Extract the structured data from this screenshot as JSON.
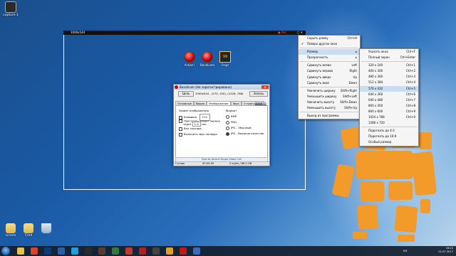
{
  "desktop": {
    "top_icon": {
      "label": "capture 1"
    },
    "bottom_icons": [
      {
        "label": "screen",
        "icon": "folder-icon"
      },
      {
        "label": "Cmd",
        "icon": "folder-icon"
      },
      {
        "label": "",
        "icon": "recycle-bin-icon"
      }
    ],
    "apps": [
      {
        "label": "Action!",
        "icon": "action-record-icon"
      },
      {
        "label": "Bandicam",
        "icon": "bandicam-record-icon"
      },
      {
        "label": "Fraps",
        "icon": "fraps-icon"
      }
    ]
  },
  "capture_bar": {
    "resolution": "1000x544",
    "rec": "● REC",
    "controls": "▢ ✕"
  },
  "bandicam": {
    "title": "Bandicam (Не зарегистрировано)",
    "target_label": "Цель",
    "region_text": "1000x544 - (270, 150), (1228, 766)",
    "record_button": "Запись",
    "tabs": [
      "Основные",
      "Видео",
      "Изображение",
      "Звук",
      "О программе"
    ],
    "active_tab": "Изображение",
    "help_link": "Помощь",
    "capture_header": "Захват изображения",
    "hotkey_label": "Клавиша",
    "hotkey_value": "F11",
    "repeat_label": "Повторять захват экрана",
    "repeat_every": "через",
    "repeat_value": "1.0",
    "repeat_unit": "сек.",
    "cursor_label": "Вкл курсора",
    "shutter_label": "Включить звук затвора",
    "format_header": "Формат",
    "formats": [
      "BMP",
      "PNG",
      "JPG - Обычный",
      "JPG - Высокое качество"
    ],
    "selected_format_index": 3,
    "footer_link": "How to record Skype Video Call",
    "status_left": "Готово",
    "status_time": "00:00:00",
    "status_size": "0 bytes / 86.0 GB"
  },
  "context_menu": {
    "items": [
      {
        "label": "Скрыть рамку",
        "shortcut": "Ctrl+H",
        "checked": false
      },
      {
        "label": "Поверх других окон",
        "shortcut": "",
        "checked": true
      },
      {
        "sep": true
      },
      {
        "label": "Размер",
        "shortcut": "▸",
        "hl": true
      },
      {
        "label": "Прозрачность",
        "shortcut": "▸"
      },
      {
        "sep": true
      },
      {
        "label": "Сдвинуть влево",
        "shortcut": "Left"
      },
      {
        "label": "Сдвинуть вправо",
        "shortcut": "Right"
      },
      {
        "label": "Сдвинуть вверх",
        "shortcut": "Up"
      },
      {
        "label": "Сдвинуть вниз",
        "shortcut": "Down"
      },
      {
        "sep": true
      },
      {
        "label": "Увеличить ширину",
        "shortcut": "Shift+Right"
      },
      {
        "label": "Уменьшить ширину",
        "shortcut": "Shift+Left"
      },
      {
        "label": "Увеличить высоту",
        "shortcut": "Shift+Down"
      },
      {
        "label": "Уменьшить высоту",
        "shortcut": "Shift+Up"
      },
      {
        "sep": true
      },
      {
        "label": "Выход из программы",
        "shortcut": ""
      }
    ]
  },
  "size_submenu": {
    "items": [
      {
        "label": "Указать окно",
        "shortcut": "Ctrl+F"
      },
      {
        "label": "Полный экран",
        "shortcut": "Ctrl+Enter"
      },
      {
        "sep": true
      },
      {
        "label": "320 x 240",
        "shortcut": "Ctrl+1"
      },
      {
        "label": "400 x 300",
        "shortcut": "Ctrl+2"
      },
      {
        "label": "480 x 360",
        "shortcut": "Ctrl+3"
      },
      {
        "label": "512 x 384",
        "shortcut": "Ctrl+4"
      },
      {
        "label": "576 x 432",
        "shortcut": "Ctrl+5",
        "hl": true
      },
      {
        "label": "640 x 360",
        "shortcut": "Ctrl+6"
      },
      {
        "label": "640 x 480",
        "shortcut": "Ctrl+7"
      },
      {
        "label": "800 x 450",
        "shortcut": "Ctrl+8"
      },
      {
        "label": "800 x 600",
        "shortcut": "Ctrl+9"
      },
      {
        "label": "1024 x 768",
        "shortcut": "Ctrl+0"
      },
      {
        "label": "1280 x 720",
        "shortcut": ""
      },
      {
        "sep": true
      },
      {
        "label": "Подогнать до 4:3",
        "shortcut": ""
      },
      {
        "label": "Подогнать до 16:9",
        "shortcut": ""
      },
      {
        "label": "Особый размер",
        "shortcut": ""
      }
    ]
  },
  "taskbar": {
    "apps": [
      "explorer-icon",
      "chrome-icon",
      "photoshop-icon",
      "ps-icon",
      "skype-icon",
      "steam-icon",
      "game-icon",
      "word-icon",
      "media-icon",
      "bandicam-taskbar-icon",
      "obs-icon",
      "chrome2-icon",
      "record-icon",
      "audio-icon"
    ],
    "lang": "EN",
    "time": "18:22",
    "date": "01.07.2017"
  },
  "colors": {
    "accent_orange": "#f29a2a",
    "desktop_blue": "#1a5aa6"
  }
}
